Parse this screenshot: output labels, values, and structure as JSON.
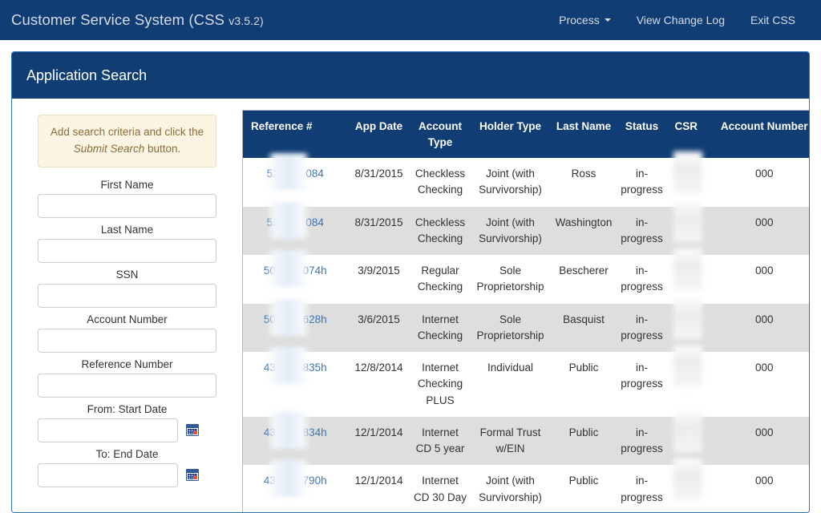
{
  "navbar": {
    "brand": "Customer Service System (CSS ",
    "brand_version": "v3.5.2)",
    "links": [
      {
        "label": "Process",
        "icon": "chevron-down-icon",
        "has_caret": true
      },
      {
        "label": "View Change Log",
        "has_caret": false
      },
      {
        "label": "Exit CSS",
        "has_caret": false
      }
    ]
  },
  "panel": {
    "title": "Application Search"
  },
  "sidebar": {
    "alert": {
      "text_before": "Add search criteria and click the ",
      "emphasis": "Submit Search",
      "text_after": " button."
    },
    "fields": [
      {
        "label": "First Name",
        "value": "",
        "placeholder": "",
        "name": "first-name"
      },
      {
        "label": "Last Name",
        "value": "",
        "placeholder": "",
        "name": "last-name"
      },
      {
        "label": "SSN",
        "value": "",
        "placeholder": "",
        "name": "ssn"
      },
      {
        "label": "Account Number",
        "value": "",
        "placeholder": "",
        "name": "account-number"
      },
      {
        "label": "Reference Number",
        "value": "",
        "placeholder": "",
        "name": "reference-number"
      }
    ],
    "date_fields": [
      {
        "label": "From: Start Date",
        "value": "",
        "placeholder": "",
        "icon": "calendar-icon"
      },
      {
        "label": "To: End Date",
        "value": "",
        "placeholder": "",
        "icon": "calendar-icon"
      }
    ]
  },
  "table": {
    "columns": [
      "Reference #",
      "App Date",
      "Account Type",
      "Holder Type",
      "Last Name",
      "Status",
      "CSR",
      "Account Number"
    ],
    "rows": [
      {
        "reference_prefix": "524",
        "reference_suffix": "084",
        "app_date": "8/31/2015",
        "account_type": "Checkless Checking",
        "holder_type": "Joint (with Survivorship)",
        "last_name": "Ross",
        "status": "in-progress",
        "csr": "",
        "account_number": "000"
      },
      {
        "reference_prefix": "524",
        "reference_suffix": "084",
        "app_date": "8/31/2015",
        "account_type": "Checkless Checking",
        "holder_type": "Joint (with Survivorship)",
        "last_name": "Washington",
        "status": "in-progress",
        "csr": "",
        "account_number": "000"
      },
      {
        "reference_prefix": "506",
        "reference_suffix": "074h",
        "app_date": "3/9/2015",
        "account_type": "Regular Checking",
        "holder_type": "Sole Proprietorship",
        "last_name": "Bescherer",
        "status": "in-progress",
        "csr": "",
        "account_number": "000"
      },
      {
        "reference_prefix": "506",
        "reference_suffix": "628h",
        "app_date": "3/6/2015",
        "account_type": "Internet Checking",
        "holder_type": "Sole Proprietorship",
        "last_name": "Basquist",
        "status": "in-progress",
        "csr": "",
        "account_number": "000"
      },
      {
        "reference_prefix": "434",
        "reference_suffix": "835h",
        "app_date": "12/8/2014",
        "account_type": "Internet Checking PLUS",
        "holder_type": "Individual",
        "last_name": "Public",
        "status": "in-progress",
        "csr": "",
        "account_number": "000"
      },
      {
        "reference_prefix": "433",
        "reference_suffix": "834h",
        "app_date": "12/1/2014",
        "account_type": "Internet CD 5 year",
        "holder_type": "Formal Trust w/EIN",
        "last_name": "Public",
        "status": "in-progress",
        "csr": "",
        "account_number": "000"
      },
      {
        "reference_prefix": "433",
        "reference_suffix": "790h",
        "app_date": "12/1/2014",
        "account_type": "Internet CD 30 Day",
        "holder_type": "Joint (with Survivorship)",
        "last_name": "Public",
        "status": "in-progress",
        "csr": "",
        "account_number": "000"
      }
    ]
  },
  "colors": {
    "navy": "#103D74",
    "panel_border": "#2f72b8",
    "link_blue": "#3f72b5",
    "alert_bg": "#fcf5e3",
    "alert_text": "#8a6d3b",
    "stripe": "#dedede"
  }
}
